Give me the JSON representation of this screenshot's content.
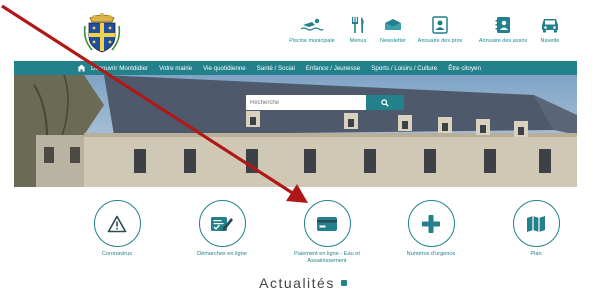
{
  "quick_links": [
    {
      "label": "Piscine municipale",
      "icon": "swimmer-icon"
    },
    {
      "label": "Menus",
      "icon": "cutlery-icon"
    },
    {
      "label": "Newsletter",
      "icon": "newsletter-icon"
    },
    {
      "label": "Annuaire des pros",
      "icon": "directory-icon"
    },
    {
      "label": "Annuaire des assos",
      "icon": "associations-icon"
    },
    {
      "label": "Navette",
      "icon": "car-icon"
    }
  ],
  "nav": {
    "items": [
      "Découvrir Montdidier",
      "Votre mairie",
      "Vie quotidienne",
      "Santé / Social",
      "Enfance / Jeunesse",
      "Sports / Loisirs / Culture",
      "Être citoyen"
    ]
  },
  "search": {
    "placeholder": "Recherche"
  },
  "services": [
    {
      "label": "Coronavirus",
      "icon": "warning-icon"
    },
    {
      "label": "Démarches en ligne",
      "icon": "form-edit-icon"
    },
    {
      "label": "Paiement en ligne - Eau et Assainissement",
      "icon": "credit-card-icon"
    },
    {
      "label": "Numéros d'urgence",
      "icon": "plus-icon"
    },
    {
      "label": "Plan",
      "icon": "map-icon"
    }
  ],
  "news": {
    "title": "Actualités"
  },
  "colors": {
    "accent": "#23818c",
    "arrow": "#b01818",
    "nav_bg": "#23818c"
  }
}
